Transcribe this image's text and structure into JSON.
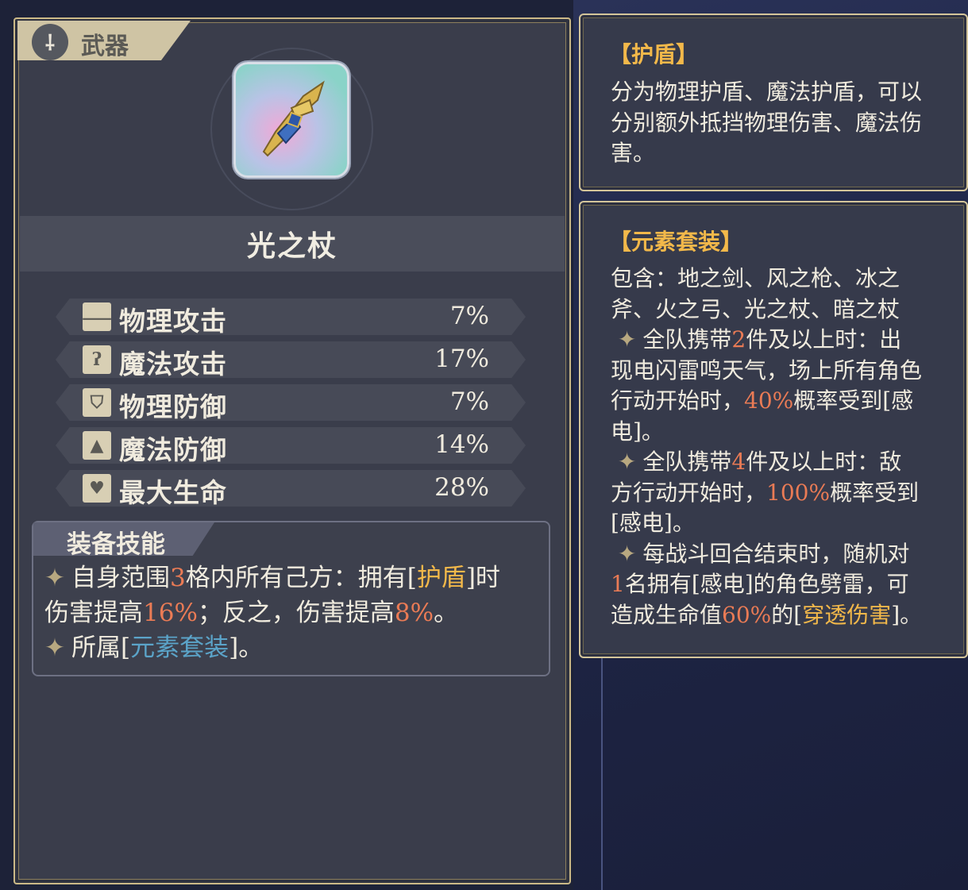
{
  "weapon": {
    "category_label": "武器",
    "category_icon": "sword-icon",
    "item_name": "光之杖",
    "item_icon": "light-staff-icon",
    "stats": [
      {
        "icon": "sword-icon",
        "name": "物理攻击",
        "value": "7%"
      },
      {
        "icon": "staff-icon",
        "name": "魔法攻击",
        "value": "17%"
      },
      {
        "icon": "shield-icon",
        "name": "物理防御",
        "value": "7%"
      },
      {
        "icon": "wizard-hat-icon",
        "name": "魔法防御",
        "value": "14%"
      },
      {
        "icon": "heart-icon",
        "name": "最大生命",
        "value": "28%"
      }
    ],
    "skill": {
      "title": "装备技能",
      "line1": {
        "a": "自身范围",
        "b": "3",
        "c": "格内所有己方：拥有[",
        "d": "护盾",
        "e": "]时"
      },
      "line2": {
        "a": "伤害提高",
        "b": "16%",
        "c": "；反之，伤害提高",
        "d": "8%",
        "e": "。"
      },
      "line3": {
        "a": "所属[",
        "b": "元素套装",
        "c": "]。"
      }
    }
  },
  "tooltip_shield": {
    "title": "【护盾】",
    "body": [
      "分为物理护盾、魔法护盾，可以",
      "分别额外抵挡物理伤害、魔法伤",
      "害。"
    ]
  },
  "tooltip_set": {
    "title": "【元素套装】",
    "l1": "包含：地之剑、风之枪、冰之",
    "l2": "斧、火之弓、光之杖、暗之杖",
    "l3": {
      "a": "全队携带",
      "b": "2",
      "c": "件及以上时：出"
    },
    "l4": "现电闪雷鸣天气，场上所有角色",
    "l5": {
      "a": "行动开始时，",
      "b": "40%",
      "c": "概率受到[感"
    },
    "l6": "电]。",
    "l7": {
      "a": "全队携带",
      "b": "4",
      "c": "件及以上时：敌"
    },
    "l8": {
      "a": "方行动开始时，",
      "b": "100%",
      "c": "概率受到"
    },
    "l9": "[感电]。",
    "l10": "每战斗回合结束时，随机对",
    "l11": {
      "a": "1",
      "b": "名拥有[感电]的角色劈雷，可"
    },
    "l12": {
      "a": "造成生命值",
      "b": "60%",
      "c": "的[",
      "d": "穿透伤害",
      "e": "]。"
    }
  },
  "colors": {
    "highlight_red": "#ea7b55",
    "highlight_gold": "#f2b84a",
    "highlight_blue": "#5ba4c9",
    "frame_gold": "#cbb987"
  }
}
